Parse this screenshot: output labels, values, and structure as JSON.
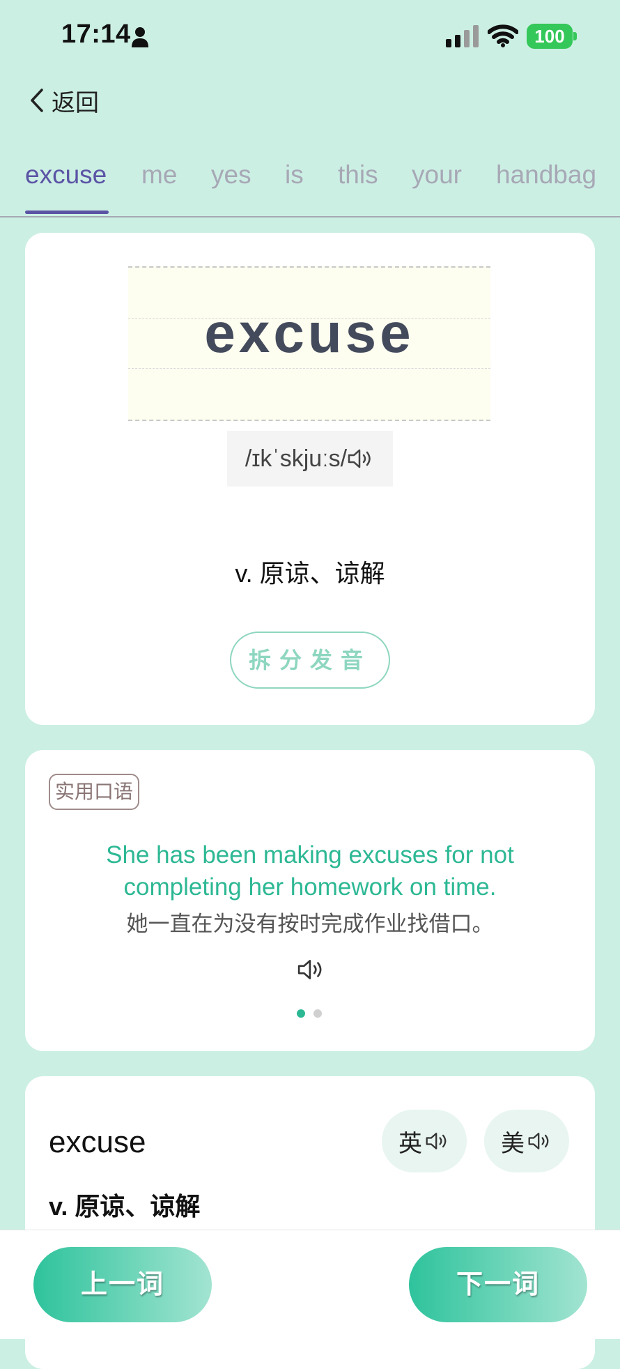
{
  "status_bar": {
    "time": "17:14",
    "battery": "100",
    "icons": [
      "person-icon",
      "signal-icon",
      "wifi-icon",
      "battery-icon"
    ]
  },
  "nav": {
    "back_label": "返回",
    "back_icon": "chevron-left-icon"
  },
  "tabs": [
    {
      "label": "excuse",
      "active": true
    },
    {
      "label": "me"
    },
    {
      "label": "yes"
    },
    {
      "label": "is"
    },
    {
      "label": "this"
    },
    {
      "label": "your"
    },
    {
      "label": "handbag"
    }
  ],
  "word_card": {
    "word": "excuse",
    "phonetic": "/ɪkˈskjuːs/",
    "meaning": "v. 原谅、谅解",
    "split_button": "拆分发音"
  },
  "sentence_card": {
    "tag": "实用口语",
    "english": "She has been making excuses for not completing her homework on time.",
    "chinese": "她一直在为没有按时完成作业找借口。",
    "page_count": 2,
    "current_page": 1
  },
  "detail_card": {
    "word": "excuse",
    "uk_label": "英",
    "us_label": "美",
    "meaning": "v. 原谅、谅解"
  },
  "bottom_bar": {
    "prev_label": "上一词",
    "next_label": "下一词"
  },
  "colors": {
    "background": "#CCEFE4",
    "accent": "#2DB894",
    "tab_active": "#5B54A5"
  }
}
